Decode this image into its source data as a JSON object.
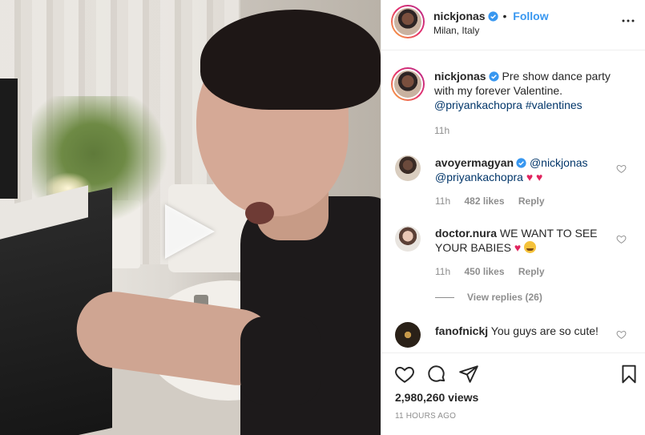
{
  "post": {
    "username": "nickjonas",
    "follow_label": "Follow",
    "dot": "•",
    "location": "Milan, Italy"
  },
  "caption": {
    "username": "nickjonas",
    "text": "Pre show dance party with my forever Valentine.",
    "mention": "@priyankachopra",
    "hashtag": "#valentines",
    "time": "11h"
  },
  "comments": [
    {
      "username": "avoyermagyan",
      "verified": true,
      "mention1": "@nickjonas",
      "mention2": "@priyankachopra",
      "emoji": "♥ ♥",
      "time": "11h",
      "likes": "482 likes",
      "reply": "Reply"
    },
    {
      "username": "doctor.nura",
      "text": "WE WANT TO SEE YOUR BABIES",
      "emoji": "♥",
      "time": "11h",
      "likes": "450 likes",
      "reply": "Reply",
      "view_replies": "View replies (26)"
    },
    {
      "username": "fanofnickj",
      "text": "You guys are so cute!"
    }
  ],
  "footer": {
    "views": "2,980,260 views",
    "ago": "11 HOURS AGO"
  },
  "colors": {
    "link_blue": "#3897f0",
    "verified_blue": "#3897f0",
    "heart_red": "#e0245e"
  }
}
